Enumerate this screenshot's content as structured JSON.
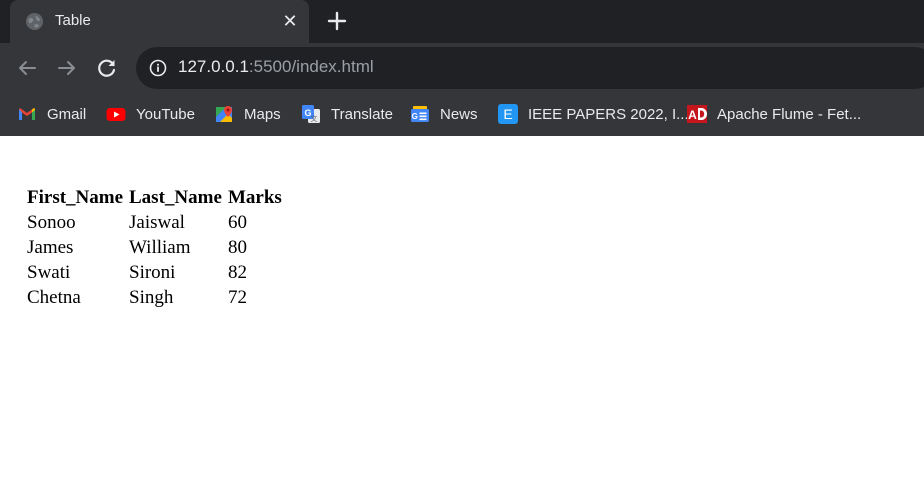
{
  "browser": {
    "tab": {
      "title": "Table",
      "close_symbol": "✕"
    },
    "address": {
      "host": "127.0.0.1",
      "rest": ":5500/index.html"
    },
    "bookmarks": [
      {
        "label": "Gmail",
        "icon": "gmail-icon"
      },
      {
        "label": "YouTube",
        "icon": "youtube-icon"
      },
      {
        "label": "Maps",
        "icon": "maps-icon"
      },
      {
        "label": "Translate",
        "icon": "translate-icon"
      },
      {
        "label": "News",
        "icon": "news-icon"
      },
      {
        "label": "IEEE PAPERS 2022, I...",
        "icon": "ieee-icon"
      },
      {
        "label": "Apache Flume - Fet...",
        "icon": "apache-flume-icon"
      }
    ]
  },
  "colors": {
    "tabstrip_bg": "#202124",
    "toolbar_bg": "#35363a",
    "text_light": "#e8eaed",
    "youtube_red": "#ff0000",
    "ieee_blue": "#2196f3"
  },
  "table": {
    "headers": [
      "First_Name",
      "Last_Name",
      "Marks"
    ],
    "rows": [
      [
        "Sonoo",
        "Jaiswal",
        "60"
      ],
      [
        "James",
        "William",
        "80"
      ],
      [
        "Swati",
        "Sironi",
        "82"
      ],
      [
        "Chetna",
        "Singh",
        "72"
      ]
    ]
  }
}
